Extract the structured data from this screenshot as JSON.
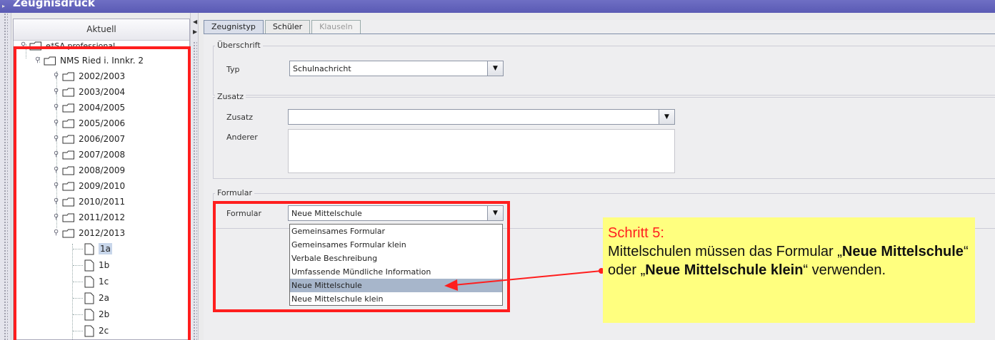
{
  "window": {
    "title": "Zeugnisdruck"
  },
  "left_panel": {
    "header": "Aktuell",
    "root": "e*SA professional",
    "school": "NMS Ried i. Innkr. 2",
    "years": [
      "2002/2003",
      "2003/2004",
      "2004/2005",
      "2005/2006",
      "2006/2007",
      "2007/2008",
      "2008/2009",
      "2009/2010",
      "2010/2011",
      "2011/2012",
      "2012/2013"
    ],
    "classes": [
      "1a",
      "1b",
      "1c",
      "2a",
      "2b",
      "2c"
    ]
  },
  "tabs": [
    {
      "label": "Zeugnistyp",
      "state": "active"
    },
    {
      "label": "Schüler",
      "state": "normal"
    },
    {
      "label": "Klauseln",
      "state": "disabled"
    }
  ],
  "ueberschrift": {
    "legend": "Überschrift",
    "typ_label": "Typ",
    "typ_value": "Schulnachricht"
  },
  "zusatz": {
    "legend": "Zusatz",
    "zusatz_label": "Zusatz",
    "zusatz_value": "",
    "anderer_label": "Anderer",
    "anderer_value": ""
  },
  "formular": {
    "legend": "Formular",
    "label": "Formular",
    "value": "Neue Mittelschule",
    "options": [
      "Gemeinsames Formular",
      "Gemeinsames Formular klein",
      "Verbale Beschreibung",
      "Umfassende Mündliche Information",
      "Neue Mittelschule",
      "Neue Mittelschule klein"
    ],
    "selected_option": "Neue Mittelschule"
  },
  "callout": {
    "step": "Schritt 5:",
    "t1": "Mittelschulen müssen das Formular „",
    "b1": "Neue Mittelschule",
    "t2": "“ oder „",
    "b2": "Neue Mittelschule klein",
    "t3": "“ verwenden."
  },
  "colors": {
    "annotation_red": "#ff1e1e",
    "callout_yellow": "#ffff7f",
    "title_bar": "#5a5ab4",
    "selection": "#a7b6cb"
  }
}
